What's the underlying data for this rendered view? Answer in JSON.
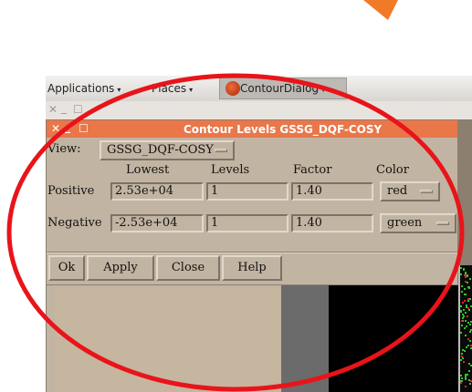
{
  "panel": {
    "applications_label": "Applications",
    "places_label": "Places",
    "task_label": "ContourDialog"
  },
  "dialog": {
    "title": "Contour Levels GSSG_DQF-COSY",
    "view_label": "View:",
    "view_value": "GSSG_DQF-COSY",
    "columns": [
      "Lowest",
      "Levels",
      "Factor",
      "Color"
    ],
    "rows": [
      {
        "label": "Positive",
        "lowest": "2.53e+04",
        "levels": "1",
        "factor": "1.40",
        "color": "red"
      },
      {
        "label": "Negative",
        "lowest": "-2.53e+04",
        "levels": "1",
        "factor": "1.40",
        "color": "green"
      }
    ],
    "buttons": {
      "ok": "Ok",
      "apply": "Apply",
      "close": "Close",
      "help": "Help"
    }
  },
  "annotation": {
    "ellipse_color": "#e8141a",
    "arrow_color": "#f07a28"
  },
  "colors": {
    "titlebar": "#e9774a",
    "dialog_bg": "#c2b4a2"
  }
}
